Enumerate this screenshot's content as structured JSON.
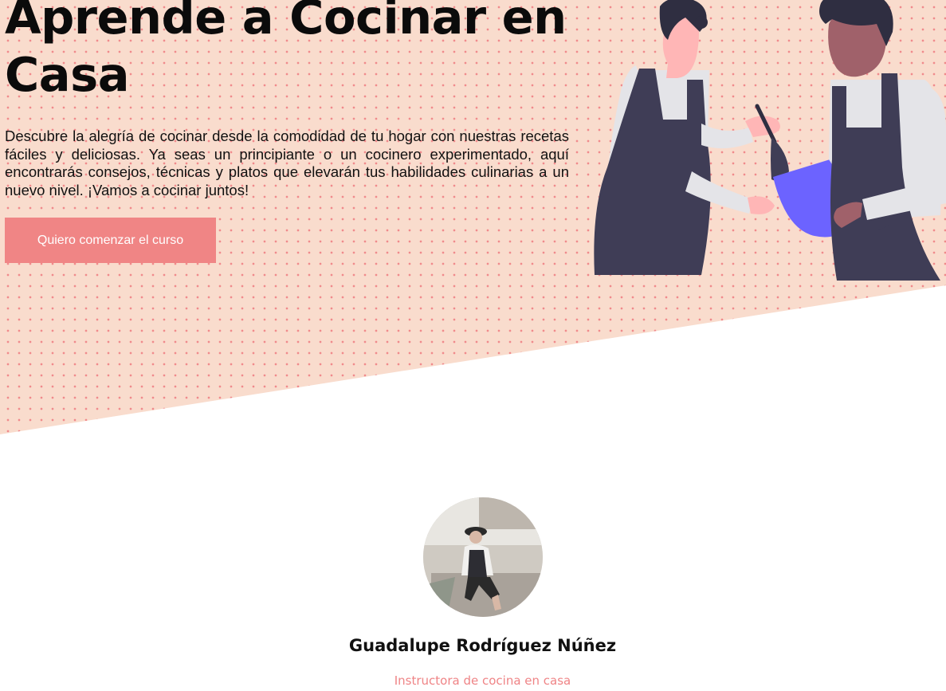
{
  "hero": {
    "title": "Aprende a Cocinar en Casa",
    "description": "Descubre la alegría de cocinar desde la comodidad de tu hogar con nuestras recetas fáciles y deliciosas. Ya seas un principiante o un cocinero experimentado, aquí encontrarás consejos, técnicas y platos que elevarán tus habilidades culinarias a un nuevo nivel. ¡Vamos a cocinar juntos!",
    "cta_label": "Quiero comenzar el curso",
    "illustration_icon": "two-cooks-illustration"
  },
  "instructor": {
    "name": "Guadalupe Rodríguez Núñez",
    "role": "Instructora de cocina en casa",
    "photo_icon": "instructor-photo"
  },
  "colors": {
    "hero_background": "#f9dccd",
    "dot_pattern": "#f08a8c",
    "accent": "#f08585",
    "apron": "#3f3d56",
    "bowl": "#6c63ff"
  }
}
